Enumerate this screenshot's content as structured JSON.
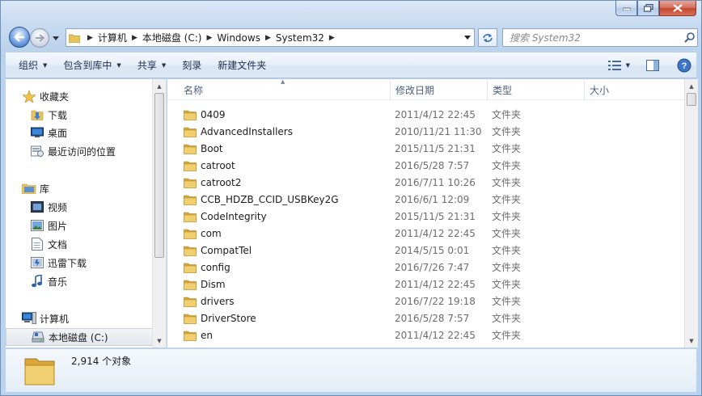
{
  "address": {
    "crumbs": [
      "计算机",
      "本地磁盘 (C:)",
      "Windows",
      "System32"
    ]
  },
  "search": {
    "placeholder": "搜索 System32"
  },
  "toolbar": {
    "organize": "组织",
    "include_in_library": "包含到库中",
    "share": "共享",
    "burn": "刻录",
    "new_folder": "新建文件夹"
  },
  "nav": {
    "favorites": "收藏夹",
    "downloads": "下载",
    "desktop": "桌面",
    "recent": "最近访问的位置",
    "libraries": "库",
    "videos": "视频",
    "pictures": "图片",
    "documents": "文档",
    "thunder": "迅雷下载",
    "music": "音乐",
    "computer": "计算机",
    "local_disk": "本地磁盘 (C:)"
  },
  "columns": {
    "name": "名称",
    "modified": "修改日期",
    "type": "类型",
    "size": "大小"
  },
  "files": [
    {
      "name": "0409",
      "date": "2011/4/12 22:45",
      "type": "文件夹"
    },
    {
      "name": "AdvancedInstallers",
      "date": "2010/11/21 11:30",
      "type": "文件夹"
    },
    {
      "name": "Boot",
      "date": "2015/11/5 21:31",
      "type": "文件夹"
    },
    {
      "name": "catroot",
      "date": "2016/5/28 7:57",
      "type": "文件夹"
    },
    {
      "name": "catroot2",
      "date": "2016/7/11 10:26",
      "type": "文件夹"
    },
    {
      "name": "CCB_HDZB_CCID_USBKey2G",
      "date": "2016/6/1 12:09",
      "type": "文件夹"
    },
    {
      "name": "CodeIntegrity",
      "date": "2015/11/5 21:31",
      "type": "文件夹"
    },
    {
      "name": "com",
      "date": "2011/4/12 22:45",
      "type": "文件夹"
    },
    {
      "name": "CompatTel",
      "date": "2014/5/15 0:01",
      "type": "文件夹"
    },
    {
      "name": "config",
      "date": "2016/7/26 7:47",
      "type": "文件夹"
    },
    {
      "name": "Dism",
      "date": "2011/4/12 22:45",
      "type": "文件夹"
    },
    {
      "name": "drivers",
      "date": "2016/7/22 19:18",
      "type": "文件夹"
    },
    {
      "name": "DriverStore",
      "date": "2016/5/28 7:57",
      "type": "文件夹"
    },
    {
      "name": "en",
      "date": "2011/4/12 22:45",
      "type": "文件夹"
    }
  ],
  "details": {
    "count": "2,914 个对象"
  }
}
